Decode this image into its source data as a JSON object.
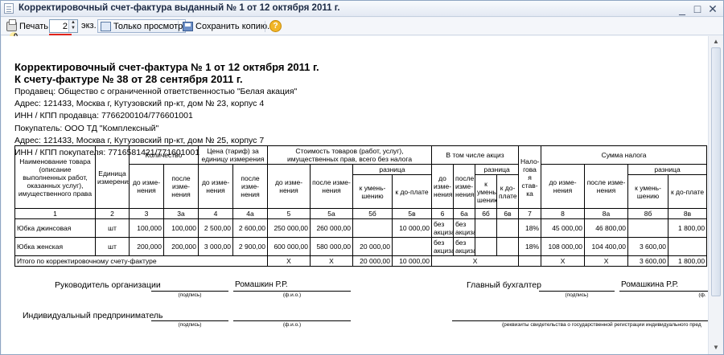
{
  "window": {
    "title": "Корректировочный счет-фактура выданный № 1 от 12 октября 2011 г.",
    "controls": [
      "_",
      "□",
      "✕"
    ]
  },
  "toolbar": {
    "print_label": "Печать",
    "copies_value": "2",
    "copies_unit": "экз.",
    "view_only_label": "Только просмотр",
    "save_copy_label": "Сохранить копию...",
    "help_label": "?"
  },
  "document": {
    "title": "Корректировочный счет-фактура № 1 от 12 октября 2011 г.",
    "subtitle": "К счету-фактуре № 38 от 28 сентября 2011 г.",
    "seller": "Продавец: Общество с ограниченной ответственностью \"Белая акация\"",
    "seller_address": "Адрес: 121433, Москва г, Кутузовский пр-кт, дом № 23, корпус 4",
    "seller_inn": "ИНН / КПП продавца: 7766200104/776601001",
    "buyer": "Покупатель: ООО ТД \"Комплексный\"",
    "buyer_address": "Адрес: 121433, Москва г, Кутузовский пр-кт, дом № 25, корпус 7",
    "buyer_inn": "ИНН / КПП покупателя: 7716581421/771601001"
  },
  "table": {
    "h_name": "Наименование товара (описание выполненных работ, оказанных услуг), имущественного права",
    "h_unit": "Единица измерения",
    "h_qty": "Количество",
    "h_price": "Цена (тариф) за единицу измерения",
    "h_cost": "Стоимость товаров (работ, услуг), имущественных прав, всего без налога",
    "h_excise": "В том числе акциз",
    "h_rate": "Нало-гова я став-ка",
    "h_tax": "Сумма налога",
    "h_before": "до изме-нения",
    "h_after": "после изме-нения",
    "h_diff": "разница",
    "h_dec": "к умень-шению",
    "h_inc": "к до-плате",
    "col_numbers": [
      "1",
      "2",
      "3",
      "3а",
      "4",
      "4а",
      "5",
      "5а",
      "5б",
      "5в",
      "6",
      "6а",
      "6б",
      "6в",
      "7",
      "8",
      "8а",
      "8б",
      "8в"
    ],
    "rows": [
      [
        "Юбка джинсовая",
        "шт",
        "100,000",
        "100,000",
        "2 500,00",
        "2 600,00",
        "250 000,00",
        "260 000,00",
        "",
        "10 000,00",
        "без акциза",
        "без акциза",
        "",
        "",
        "18%",
        "45 000,00",
        "46 800,00",
        "",
        "1 800,00"
      ],
      [
        "Юбка женская",
        "шт",
        "200,000",
        "200,000",
        "3 000,00",
        "2 900,00",
        "600 000,00",
        "580 000,00",
        "20 000,00",
        "",
        "без акциза",
        "без акциза",
        "",
        "",
        "18%",
        "108 000,00",
        "104 400,00",
        "3 600,00",
        ""
      ]
    ],
    "total_label": "Итого по корректировочному счету-фактуре",
    "total_x": "X",
    "total_5b": "20 000,00",
    "total_5v": "10 000,00",
    "total_8b": "3 600,00",
    "total_8v": "1 800,00"
  },
  "signatures": {
    "director_label": "Руководитель организации",
    "director_name": "Ромашкин Р.Р.",
    "accountant_label": "Главный бухгалтер",
    "accountant_name": "Ромашкина Р.Р.",
    "entrepreneur_label": "Индивидуальный предприниматель",
    "hint_sign": "(подпись)",
    "hint_fio": "(ф.и.о.)",
    "hint_fio_cut": "(ф.",
    "hint_registration": "(реквизиты свидетельства о государственной регистрации индивидуального пред"
  }
}
